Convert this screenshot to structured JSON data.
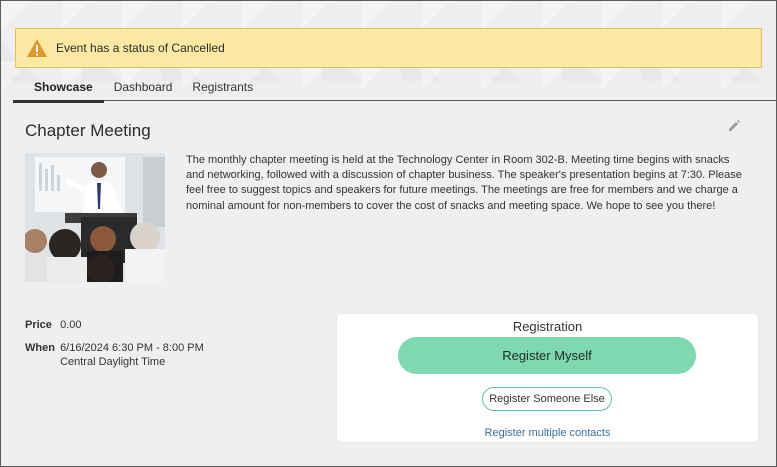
{
  "alert": {
    "icon": "warning-icon",
    "text": "Event has a status of Cancelled",
    "color": "#fbe9a3"
  },
  "tabs": [
    {
      "label": "Showcase",
      "active": true
    },
    {
      "label": "Dashboard",
      "active": false
    },
    {
      "label": "Registrants",
      "active": false
    }
  ],
  "event": {
    "title": "Chapter Meeting",
    "edit_icon": "pencil-icon",
    "image": "presenter-photo",
    "description": "The monthly chapter meeting is held at the Technology Center in Room 302-B. Meeting time begins with snacks and networking, followed with a discussion of chapter business. The speaker's presentation begins at 7:30. Please feel free to suggest topics and speakers for future meetings. The meetings are free for members and we charge a nominal amount for non-members to cover the cost of snacks and meeting space. We hope to see you there!",
    "price_label": "Price",
    "price_value": "0.00",
    "when_label": "When",
    "when_value": "6/16/2024 6:30 PM - 8:00 PM",
    "timezone": "Central Daylight Time"
  },
  "registration": {
    "title": "Registration",
    "register_myself": "Register Myself",
    "register_someone_else": "Register Someone Else",
    "register_multiple": "Register multiple contacts",
    "accent": "#7fd8b0",
    "link_color": "#3a6f9a"
  }
}
